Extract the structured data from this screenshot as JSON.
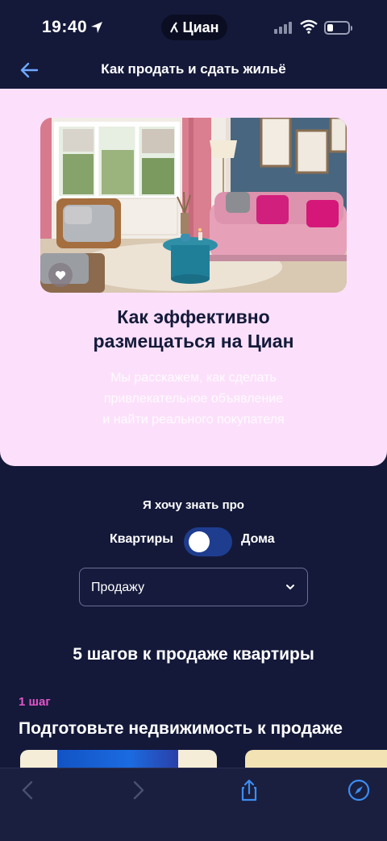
{
  "status_bar": {
    "time": "19:40",
    "pill_label": "Циан",
    "icons": [
      "location-arrow-icon",
      "cellular-signal-icon",
      "wifi-icon",
      "battery-icon"
    ]
  },
  "header": {
    "title": "Как продать и сдать жильё",
    "back_icon": "arrow-left-icon"
  },
  "hero": {
    "title": "Как эффективно\nразмещаться на Циан",
    "subtitle": "Мы расскажем, как сделать\nпривлекательное объявление\nи найти реального покупателя",
    "image": "living-room-photo",
    "favorite_icon": "heart-icon",
    "background": "#fce0fb"
  },
  "filters": {
    "label": "Я хочу знать про",
    "toggle_left": "Квартиры",
    "toggle_right": "Дома",
    "toggle_on": false,
    "select_value": "Продажу"
  },
  "steps": {
    "section_title": "5 шагов к продаже квартиры",
    "step_badge": "1 шаг",
    "step_title": "Подготовьте недвижимость к продаже"
  },
  "browser_bar": {
    "icons": [
      "chevron-left-icon",
      "chevron-right-icon",
      "share-icon",
      "compass-icon"
    ]
  },
  "colors": {
    "page_bg": "#14193a",
    "accent_pink": "#e455c9",
    "toggle_track": "#1e3d8f",
    "browser_blue": "#3d8cf0"
  }
}
